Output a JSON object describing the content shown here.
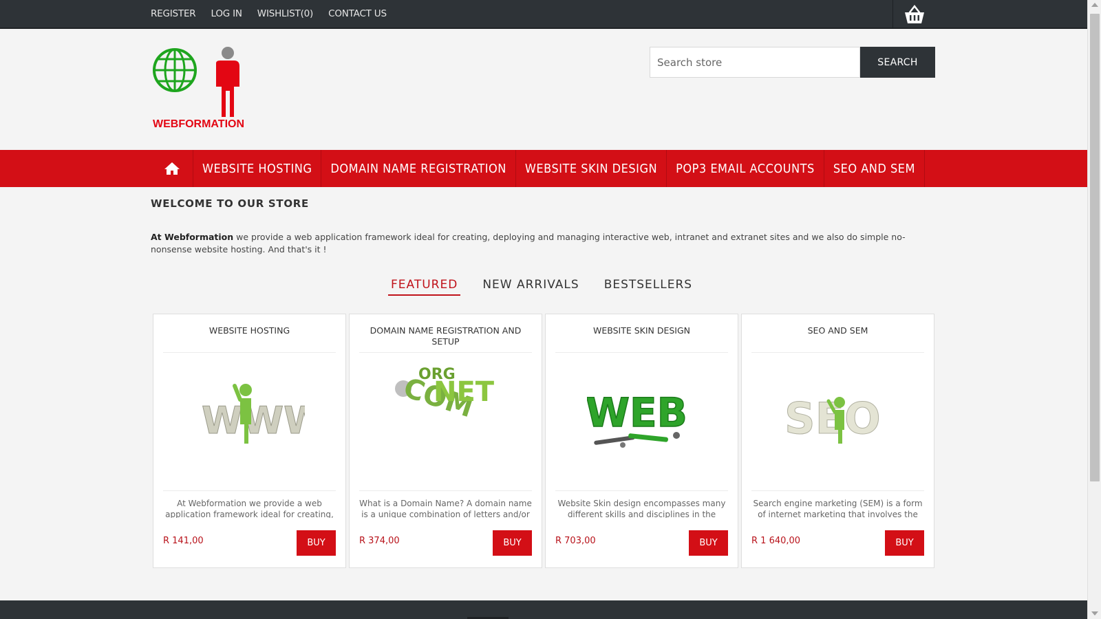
{
  "top_links": [
    "REGISTER",
    "LOG IN",
    "WISHLIST(0)",
    "CONTACT US"
  ],
  "cart_icon": "basket-icon",
  "logo_text": "WEBFORMATION",
  "search": {
    "placeholder": "Search store",
    "button": "SEARCH"
  },
  "nav": {
    "home_icon": "home-icon",
    "items": [
      "WEBSITE HOSTING",
      "DOMAIN NAME REGISTRATION",
      "WEBSITE SKIN DESIGN",
      "POP3 EMAIL ACCOUNTS",
      "SEO AND SEM"
    ]
  },
  "welcome_title": "WELCOME TO OUR STORE",
  "intro": {
    "strong": "At Webformation",
    "rest": " we provide a web application framework ideal for creating, deploying and managing interactive web, intranet and extranet sites and we also do simple no-nonsense website hosting. And that's it !"
  },
  "tabs": [
    "FEATURED",
    "NEW ARRIVALS",
    "BESTSELLERS"
  ],
  "products": [
    {
      "title": "WEBSITE HOSTING",
      "desc": "At Webformation we provide a web application framework ideal for creating,",
      "price": "R 141,00",
      "buy": "BUY"
    },
    {
      "title": "DOMAIN NAME REGISTRATION AND SETUP",
      "desc": "What is a Domain Name? A domain name is a unique combination of letters and/or",
      "price": "R 374,00",
      "buy": "BUY"
    },
    {
      "title": "WEBSITE SKIN DESIGN",
      "desc": "Website Skin design encompasses many different skills and disciplines in the",
      "price": "R 703,00",
      "buy": "BUY"
    },
    {
      "title": "SEO AND SEM",
      "desc": "Search engine marketing (SEM) is a form of internet marketing that involves the",
      "price": "R 1 640,00",
      "buy": "BUY"
    }
  ],
  "colors": {
    "brand_red": "#d30f16",
    "dark": "#2e3337",
    "price_red": "#b8121a",
    "globe_green": "#1ea51e"
  }
}
